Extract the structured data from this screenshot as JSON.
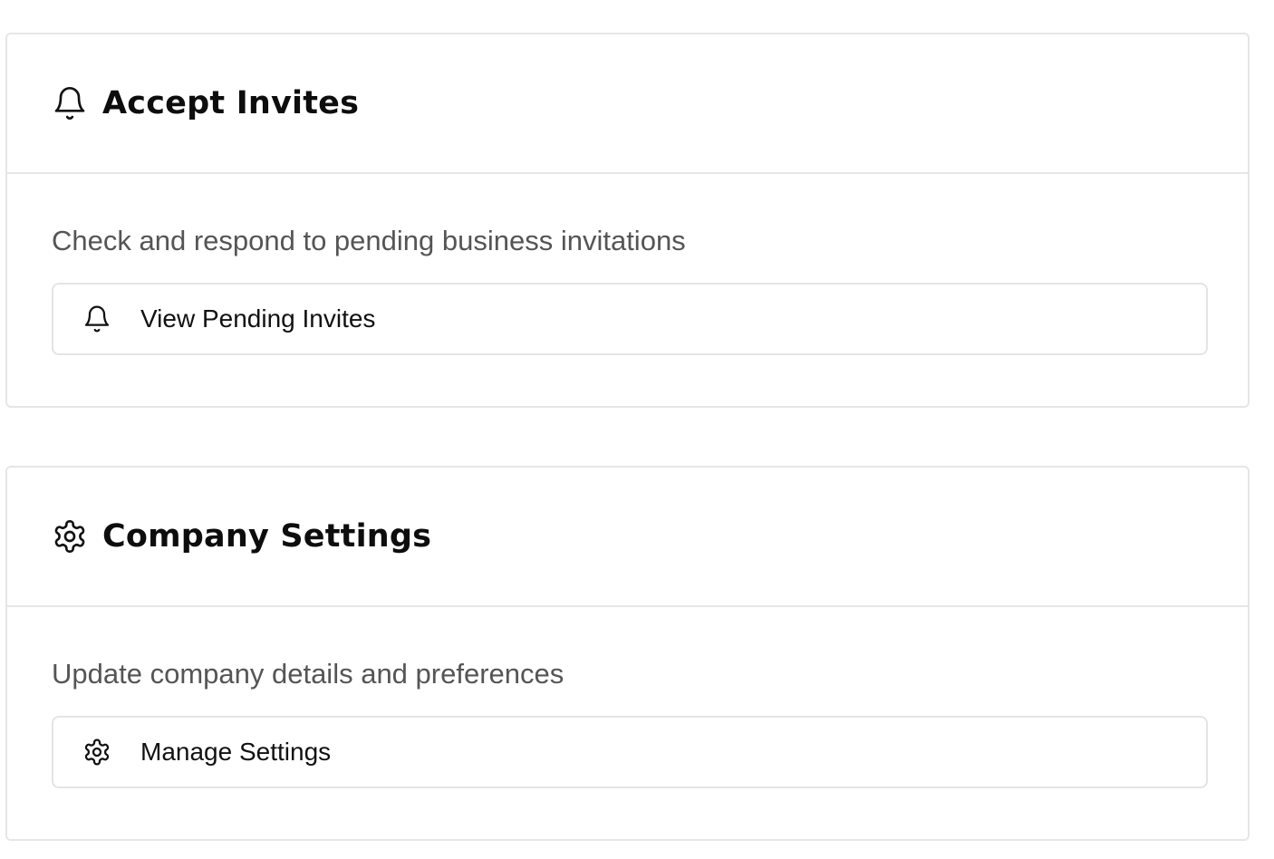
{
  "cards": [
    {
      "title": "Accept Invites",
      "icon": "bell-icon",
      "description": "Check and respond to pending business invitations",
      "action": {
        "label": "View Pending Invites",
        "icon": "bell-icon"
      }
    },
    {
      "title": "Company Settings",
      "icon": "gear-icon",
      "description": "Update company details and preferences",
      "action": {
        "label": "Manage Settings",
        "icon": "gear-icon"
      }
    }
  ],
  "colors": {
    "border": "#e6e6e6",
    "title": "#0d0d0d",
    "description": "#555555",
    "background": "#ffffff"
  }
}
